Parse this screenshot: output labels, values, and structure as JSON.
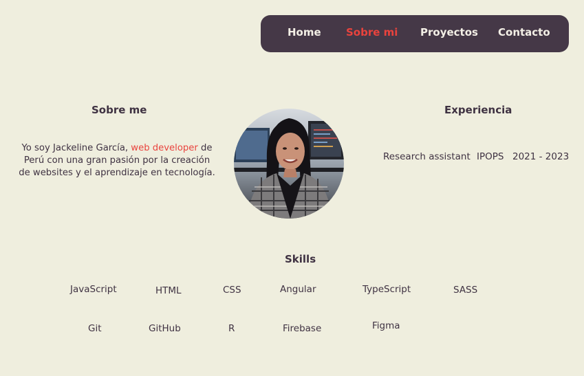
{
  "nav": {
    "home": "Home",
    "about": "Sobre mi",
    "projects": "Proyectos",
    "contact": "Contacto"
  },
  "about": {
    "title": "Sobre me",
    "text_prefix": "Yo soy Jackeline García, ",
    "highlight": "web developer",
    "text_suffix": " de Perú con una gran pasión por la creación de websites y el aprendizaje en tecnología."
  },
  "experience": {
    "title": "Experiencia",
    "role": "Research assistant",
    "organization": "IPOPS",
    "period": "2021 - 2023"
  },
  "skills": {
    "title": "Skills",
    "row1": [
      "JavaScript",
      "HTML",
      "CSS",
      "Angular",
      "TypeScript",
      "SASS"
    ],
    "row2": [
      "Git",
      "GitHub",
      "R",
      "Firebase",
      "Figma"
    ]
  },
  "colors": {
    "background": "#efeede",
    "nav_background": "#453847",
    "accent": "#e9433d",
    "text": "#3f3242"
  }
}
